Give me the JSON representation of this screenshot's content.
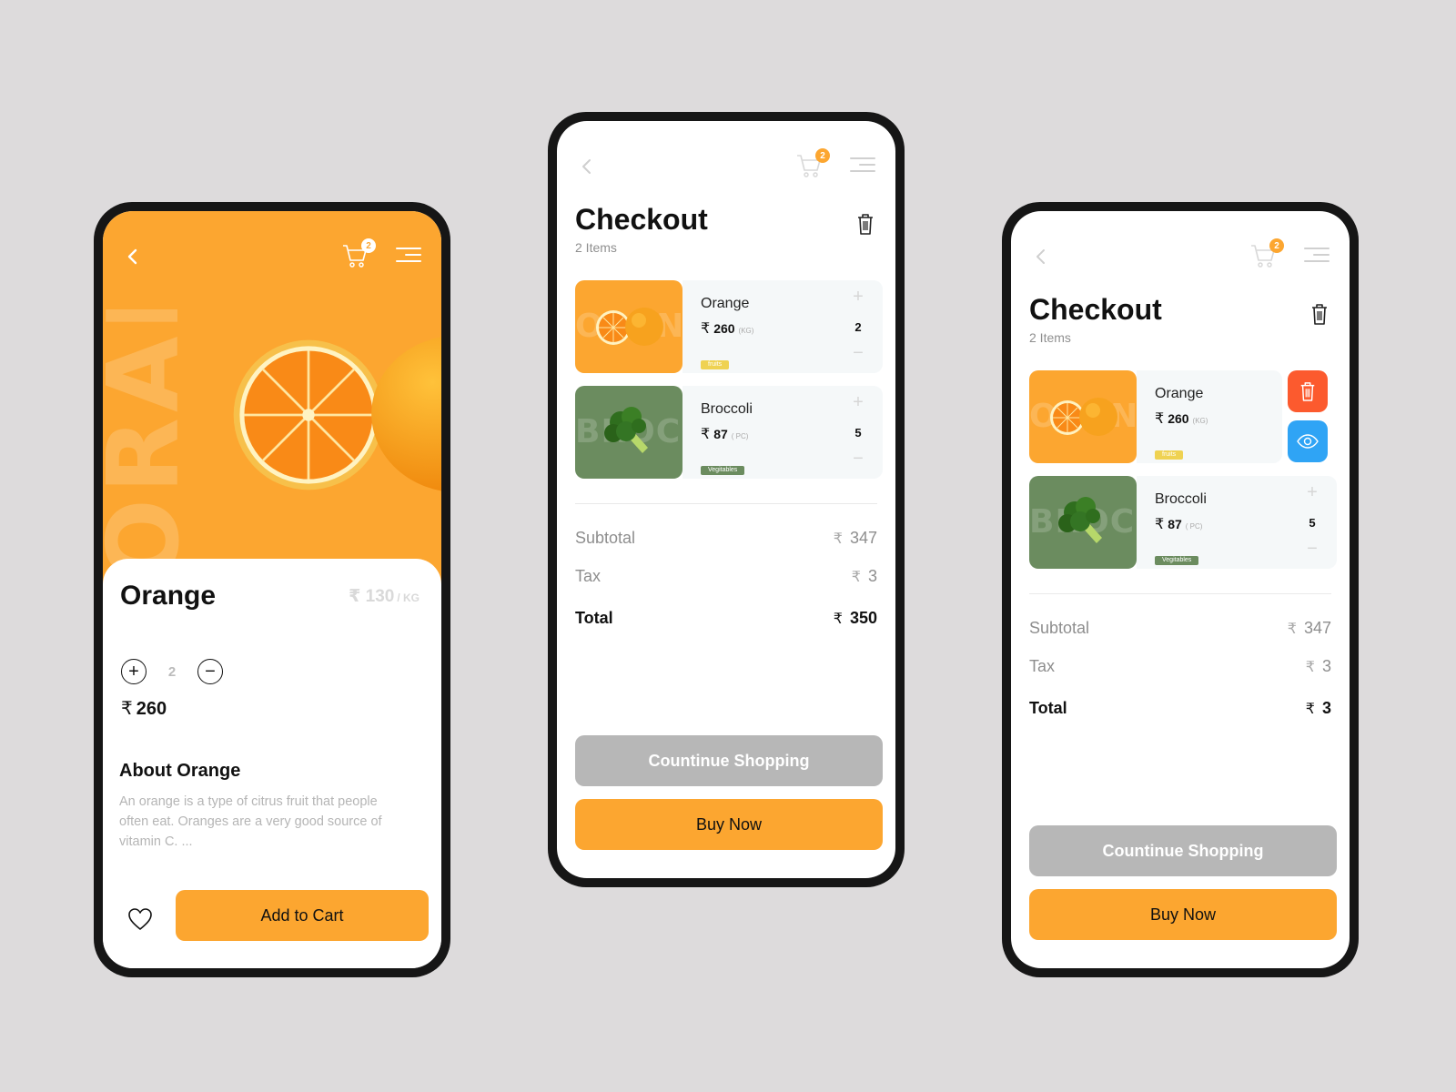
{
  "currency_symbol": "₹",
  "colors": {
    "accent": "#fca630",
    "background": "#dddbdc",
    "continue_button": "#b7b7b7",
    "delete_action": "#fc5a2e",
    "view_action": "#2fa4f5",
    "tag_fruits": "#efd252",
    "tag_vegetables": "#6b8c5f"
  },
  "product_screen": {
    "cart_badge": "2",
    "background_word": "ORANGE",
    "title": "Orange",
    "unit_price": "130",
    "unit_label": "/ KG",
    "quantity": "2",
    "plus_label": "+",
    "minus_label": "−",
    "total_price": "260",
    "about_title": "About Orange",
    "about_text": "An orange is a type of citrus fruit that people often eat. Oranges are a very good source of vitamin C. ...",
    "add_to_cart_label": "Add to Cart"
  },
  "checkout_screen": {
    "cart_badge": "2",
    "title": "Checkout",
    "item_count": "2 Items",
    "items": [
      {
        "name": "Orange",
        "price": "260",
        "unit": "(KG)",
        "tag": "fruits",
        "quantity": "2",
        "thumb_word": "ORANGE"
      },
      {
        "name": "Broccoli",
        "price": "87",
        "unit": "( PC)",
        "tag": "Vegitables",
        "quantity": "5",
        "thumb_word": "BROCCOLI"
      }
    ],
    "subtotal_label": "Subtotal",
    "subtotal_value": "347",
    "tax_label": "Tax",
    "tax_value": "3",
    "total_label": "Total",
    "total_value": "350",
    "continue_label": "Countinue Shopping",
    "buy_label": "Buy Now",
    "plus_label": "+",
    "minus_label": "−"
  },
  "checkout_swipe_screen": {
    "cart_badge": "2",
    "title": "Checkout",
    "item_count": "2 Items",
    "items": [
      {
        "name": "Orange",
        "price": "260",
        "unit": "(KG)",
        "tag": "fruits",
        "thumb_word": "ORANGE"
      },
      {
        "name": "Broccoli",
        "price": "87",
        "unit": "( PC)",
        "tag": "Vegitables",
        "quantity": "5",
        "thumb_word": "BROCCOLI"
      }
    ],
    "subtotal_label": "Subtotal",
    "subtotal_value": "347",
    "tax_label": "Tax",
    "tax_value": "3",
    "total_label": "Total",
    "total_value": "3",
    "continue_label": "Countinue Shopping",
    "buy_label": "Buy Now",
    "plus_label": "+",
    "minus_label": "−"
  }
}
